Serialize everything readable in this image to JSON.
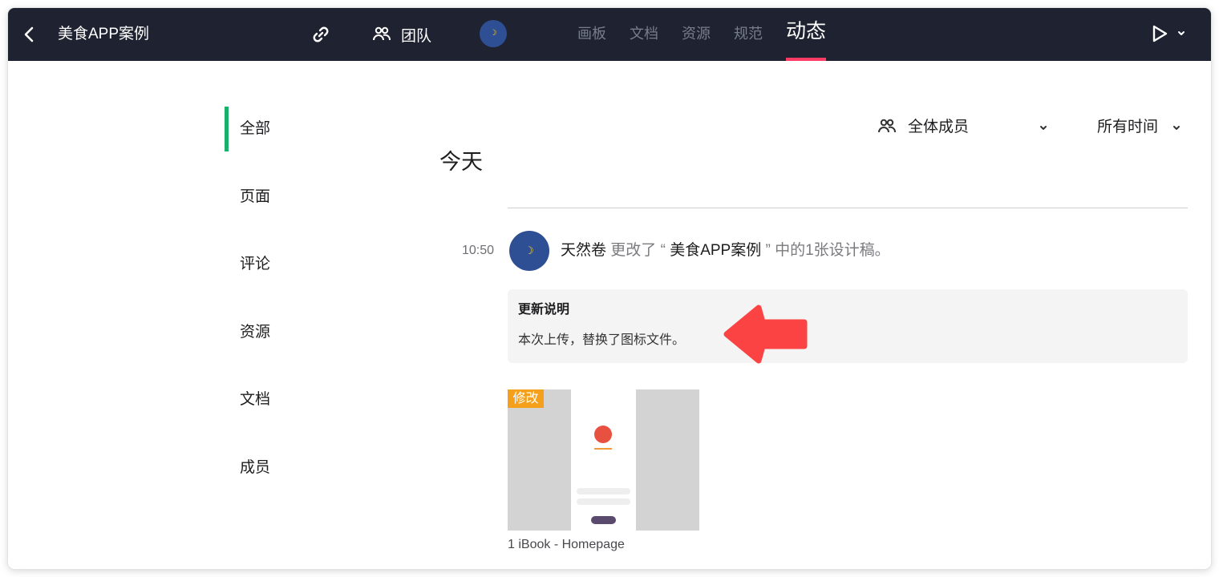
{
  "topbar": {
    "back_icon": "chevron-left-icon",
    "project_title": "美食APP案例",
    "link_icon": "link-icon",
    "team_icon": "people-icon",
    "team_label": "团队",
    "tabs": [
      {
        "label": "画板",
        "active": false
      },
      {
        "label": "文档",
        "active": false
      },
      {
        "label": "资源",
        "active": false
      },
      {
        "label": "规范",
        "active": false
      },
      {
        "label": "动态",
        "active": true
      }
    ],
    "play_icon": "play-icon",
    "accent_color": "#ff3b66",
    "bar_color": "#1f2331"
  },
  "sidebar": {
    "items": [
      {
        "label": "全部",
        "active": true
      },
      {
        "label": "页面",
        "active": false
      },
      {
        "label": "评论",
        "active": false
      },
      {
        "label": "资源",
        "active": false
      },
      {
        "label": "文档",
        "active": false
      },
      {
        "label": "成员",
        "active": false
      }
    ],
    "active_color": "#1bb06a"
  },
  "filters": {
    "members_label": "全体成员",
    "time_label": "所有时间"
  },
  "feed": {
    "day_heading": "今天",
    "activity": {
      "time": "10:50",
      "user": "天然卷",
      "action_prefix": "更改了 “",
      "project": "美食APP案例",
      "action_suffix": "” 中的1张设计稿。"
    },
    "note": {
      "title": "更新说明",
      "body": "本次上传，替换了图标文件。"
    },
    "thumbnail": {
      "badge": "修改",
      "caption": "1 iBook - Homepage",
      "badge_color": "#f5a01a"
    }
  }
}
